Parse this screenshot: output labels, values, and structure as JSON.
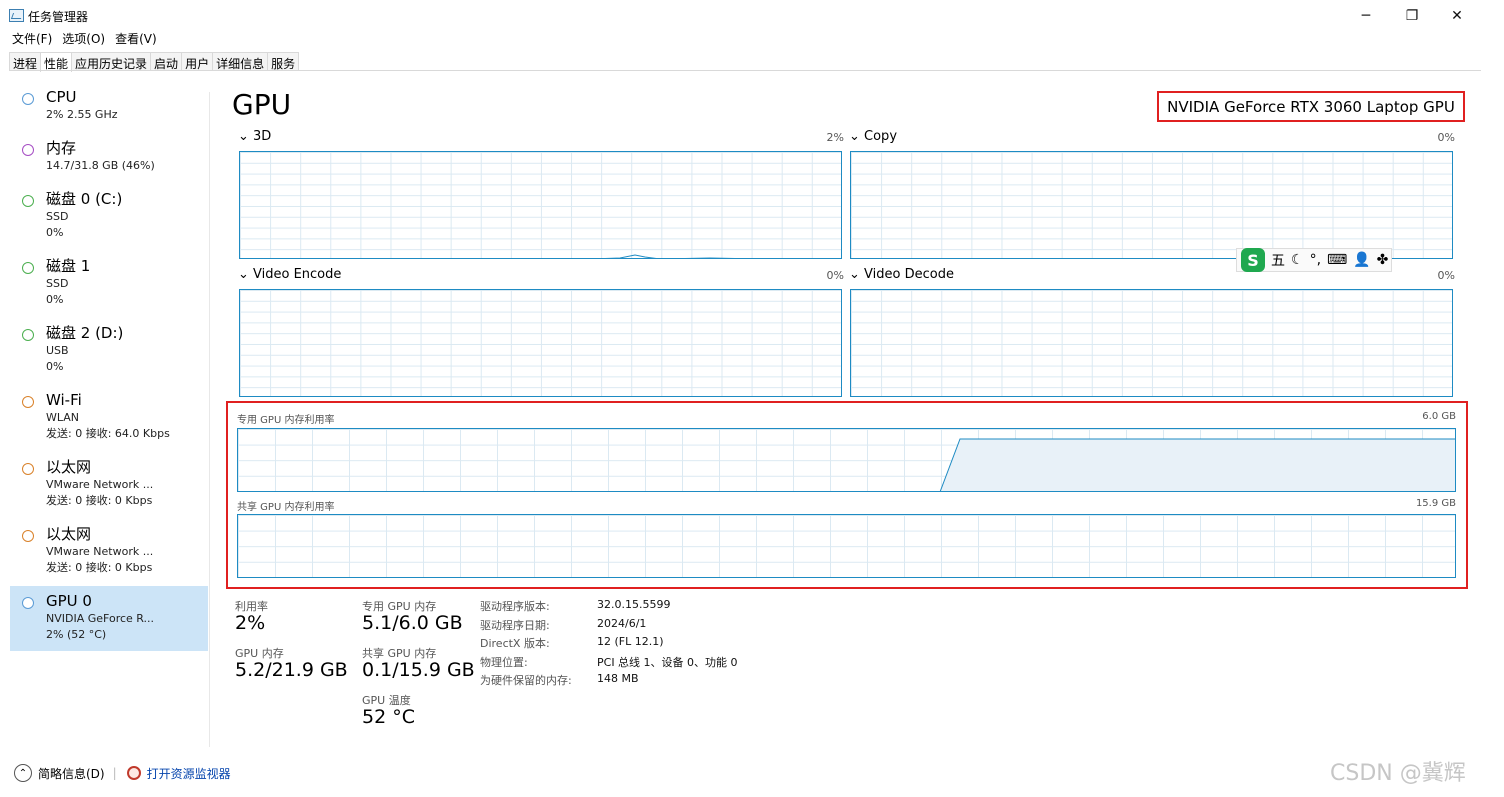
{
  "window": {
    "title": "任务管理器"
  },
  "window_controls": {
    "minimize": "─",
    "restore": "❐",
    "close": "✕"
  },
  "menu": [
    "文件(F)",
    "选项(O)",
    "查看(V)"
  ],
  "tabs": [
    "进程",
    "性能",
    "应用历史记录",
    "启动",
    "用户",
    "详细信息",
    "服务"
  ],
  "active_tab": "性能",
  "sidebar": [
    {
      "title": "CPU",
      "lines": [
        "2% 2.55 GHz"
      ],
      "color": "#5b9bd5"
    },
    {
      "title": "内存",
      "lines": [
        "14.7/31.8 GB (46%)"
      ],
      "color": "#a64ec4"
    },
    {
      "title": "磁盘 0 (C:)",
      "lines": [
        "SSD",
        "0%"
      ],
      "color": "#4caf50"
    },
    {
      "title": "磁盘 1",
      "lines": [
        "SSD",
        "0%"
      ],
      "color": "#4caf50"
    },
    {
      "title": "磁盘 2 (D:)",
      "lines": [
        "USB",
        "0%"
      ],
      "color": "#4caf50"
    },
    {
      "title": "Wi-Fi",
      "lines": [
        "WLAN",
        "发送: 0 接收: 64.0 Kbps"
      ],
      "color": "#d9822b"
    },
    {
      "title": "以太网",
      "lines": [
        "VMware Network ...",
        "发送: 0 接收: 0 Kbps"
      ],
      "color": "#d9822b"
    },
    {
      "title": "以太网",
      "lines": [
        "VMware Network ...",
        "发送: 0 接收: 0 Kbps"
      ],
      "color": "#d9822b"
    },
    {
      "title": "GPU 0",
      "lines": [
        "NVIDIA GeForce R...",
        "2% (52 °C)"
      ],
      "color": "#5b9bd5",
      "selected": true
    }
  ],
  "main": {
    "title": "GPU",
    "model": "NVIDIA GeForce RTX 3060 Laptop GPU",
    "engines": [
      {
        "label": "3D",
        "value": "2%"
      },
      {
        "label": "Copy",
        "value": "0%"
      },
      {
        "label": "Video Encode",
        "value": "0%"
      },
      {
        "label": "Video Decode",
        "value": "0%"
      }
    ],
    "dedicated": {
      "label": "专用 GPU 内存利用率",
      "max": "6.0 GB"
    },
    "shared": {
      "label": "共享 GPU 内存利用率",
      "max": "15.9 GB"
    }
  },
  "stats": {
    "utilization": {
      "label": "利用率",
      "value": "2%"
    },
    "gpu_memory": {
      "label": "GPU 内存",
      "value": "5.2/21.9 GB"
    },
    "dedicated_memory": {
      "label": "专用 GPU 内存",
      "value": "5.1/6.0 GB"
    },
    "shared_memory": {
      "label": "共享 GPU 内存",
      "value": "0.1/15.9 GB"
    },
    "temperature": {
      "label": "GPU 温度",
      "value": "52 °C"
    }
  },
  "details": [
    {
      "label": "驱动程序版本:",
      "value": "32.0.15.5599"
    },
    {
      "label": "驱动程序日期:",
      "value": "2024/6/1"
    },
    {
      "label": "DirectX 版本:",
      "value": "12 (FL 12.1)"
    },
    {
      "label": "物理位置:",
      "value": "PCI 总线 1、设备 0、功能 0"
    },
    {
      "label": "为硬件保留的内存:",
      "value": "148 MB"
    }
  ],
  "ime_toolbar": {
    "logo": "S",
    "items": [
      "五",
      "☾",
      "°,",
      "⌨",
      "👤",
      "✤"
    ]
  },
  "footer": {
    "fewer_details": "简略信息(D)",
    "resource_monitor": "打开资源监视器"
  },
  "watermark": "CSDN @冀辉",
  "colors": {
    "accent": "#1e8bc3",
    "highlight": "#e02020",
    "selected_bg": "#cce4f7",
    "link": "#0645ad"
  }
}
